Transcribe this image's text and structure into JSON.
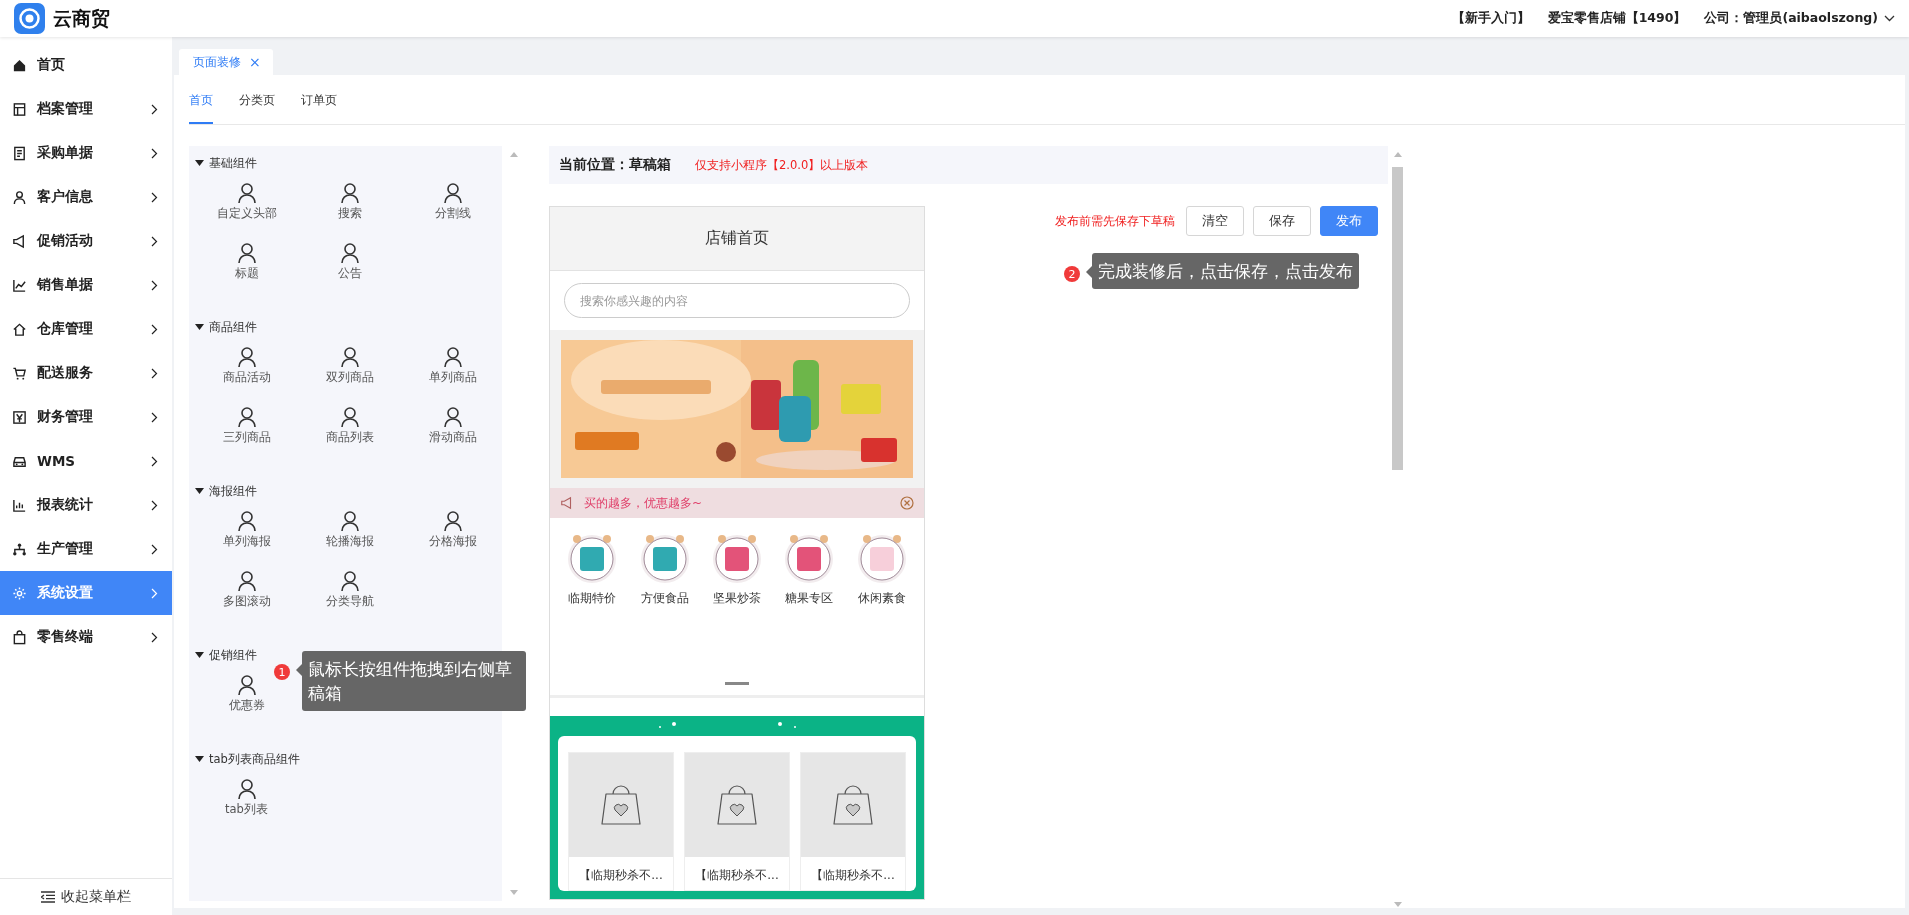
{
  "app": {
    "title": "云商贸"
  },
  "header_links": [
    {
      "label": "【新手入门】",
      "dropdown": false
    },
    {
      "label": "爱宝零售店铺【1490】",
      "dropdown": false
    },
    {
      "label": "公司：管理员(aibaolszong)",
      "dropdown": true
    }
  ],
  "sidebar": {
    "items": [
      {
        "label": "首页",
        "selected": false,
        "expandable": false
      },
      {
        "label": "档案管理",
        "selected": false,
        "expandable": true
      },
      {
        "label": "采购单据",
        "selected": false,
        "expandable": true
      },
      {
        "label": "客户信息",
        "selected": false,
        "expandable": true
      },
      {
        "label": "促销活动",
        "selected": false,
        "expandable": true
      },
      {
        "label": "销售单据",
        "selected": false,
        "expandable": true
      },
      {
        "label": "仓库管理",
        "selected": false,
        "expandable": true
      },
      {
        "label": "配送服务",
        "selected": false,
        "expandable": true
      },
      {
        "label": "财务管理",
        "selected": false,
        "expandable": true
      },
      {
        "label": "WMS",
        "selected": false,
        "expandable": true
      },
      {
        "label": "报表统计",
        "selected": false,
        "expandable": true
      },
      {
        "label": "生产管理",
        "selected": false,
        "expandable": true
      },
      {
        "label": "系统设置",
        "selected": true,
        "expandable": true
      },
      {
        "label": "零售终端",
        "selected": false,
        "expandable": true
      }
    ],
    "collapse": "收起菜单栏"
  },
  "page_tabs": [
    {
      "label": "页面装修",
      "selected": true,
      "close": "×"
    }
  ],
  "sub_tabs": [
    {
      "label": "首页",
      "selected": true
    },
    {
      "label": "分类页",
      "selected": false
    },
    {
      "label": "订单页",
      "selected": false
    }
  ],
  "component_groups": [
    {
      "title": "基础组件",
      "expanded": true,
      "items": [
        "自定义头部",
        "搜索",
        "分割线",
        "标题",
        "公告"
      ]
    },
    {
      "title": "商品组件",
      "expanded": true,
      "items": [
        "商品活动",
        "双列商品",
        "单列商品",
        "三列商品",
        "商品列表",
        "滑动商品"
      ]
    },
    {
      "title": "海报组件",
      "expanded": true,
      "items": [
        "单列海报",
        "轮播海报",
        "分格海报",
        "多图滚动",
        "分类导航"
      ]
    },
    {
      "title": "促销组件",
      "expanded": true,
      "items": [
        "优惠券"
      ]
    },
    {
      "title": "tab列表商品组件",
      "expanded": true,
      "items": [
        "tab列表"
      ]
    }
  ],
  "location": {
    "label": "当前位置：草稿箱",
    "notice": "仅支持小程序【2.0.0】以上版本"
  },
  "preview": {
    "title": "店铺首页",
    "search": {
      "placeholder": "搜索你感兴趣的内容"
    },
    "banner": {
      "kind": "picture"
    },
    "notice": "买的越多，优惠越多~",
    "categories": [
      "临期特价",
      "方便食品",
      "坚果炒茶",
      "糖果专区",
      "休闲素食"
    ],
    "products": [
      "【临期秒杀不...",
      "【临期秒杀不...",
      "【临期秒杀不..."
    ]
  },
  "actions": {
    "hint": "发布前需先保存下草稿",
    "buttons": [
      {
        "label": "清空",
        "kind": "default"
      },
      {
        "label": "保存",
        "kind": "default"
      },
      {
        "label": "发布",
        "kind": "primary"
      }
    ]
  },
  "tips": [
    {
      "number": "1",
      "text": "鼠标长按组件拖拽到右侧草稿箱"
    },
    {
      "number": "2",
      "text": "完成装修后，点击保存，点击发布"
    }
  ]
}
